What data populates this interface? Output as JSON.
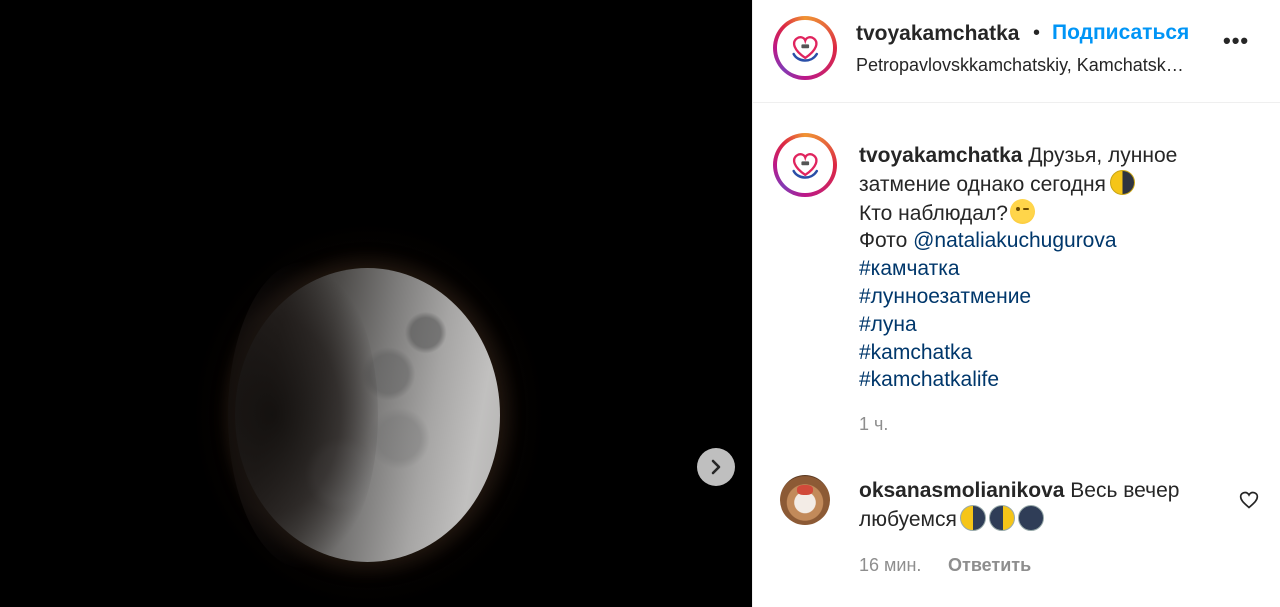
{
  "media": {
    "next_icon": "chevron-right-icon"
  },
  "header": {
    "username": "tvoyakamchatka",
    "separator": "•",
    "follow_label": "Подписаться",
    "location": "Petropavlovskkamchatskiy, Kamchatskiy kray",
    "more_label": "•••",
    "colors": {
      "follow": "#0095f6",
      "text": "#262626"
    }
  },
  "caption": {
    "username": "tvoyakamchatka",
    "line1": "Друзья, лунное",
    "line2": "затмение однако сегодня",
    "line3": "Кто наблюдал?",
    "photo_prefix": "Фото",
    "mention": "@nataliakuchugurova",
    "hashtags": [
      "#камчатка",
      "#лунноезатмение",
      "#луна",
      "#kamchatka",
      "#kamchatkalife"
    ],
    "time": "1 ч.",
    "colors": {
      "link": "#00376b",
      "muted": "#8e8e8e"
    }
  },
  "comment": {
    "username": "oksanasmolianikova",
    "text_line1": "Весь вечер",
    "text_line2": "любуемся",
    "time": "16 мин.",
    "reply_label": "Ответить",
    "like_icon": "heart-outline-icon"
  }
}
